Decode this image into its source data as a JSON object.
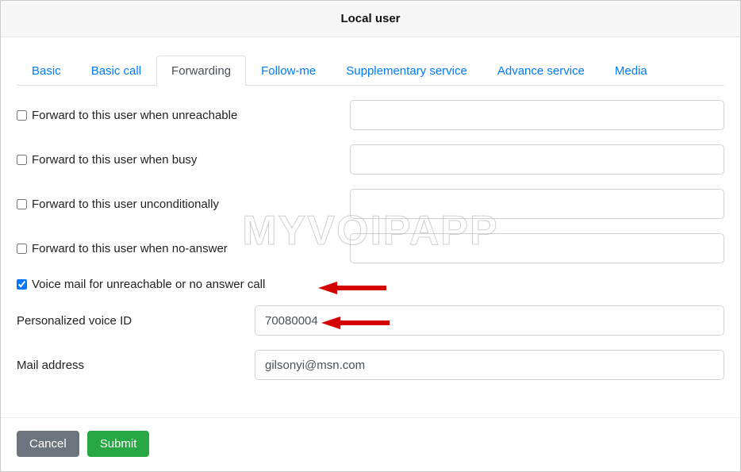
{
  "header": {
    "title": "Local user"
  },
  "tabs": [
    {
      "label": "Basic"
    },
    {
      "label": "Basic call"
    },
    {
      "label": "Forwarding",
      "active": true
    },
    {
      "label": "Follow-me"
    },
    {
      "label": "Supplementary service"
    },
    {
      "label": "Advance service"
    },
    {
      "label": "Media"
    }
  ],
  "forwarding": {
    "unreachable": {
      "label": "Forward to this user when unreachable",
      "checked": false,
      "value": ""
    },
    "busy": {
      "label": "Forward to this user when busy",
      "checked": false,
      "value": ""
    },
    "uncond": {
      "label": "Forward to this user unconditionally",
      "checked": false,
      "value": ""
    },
    "noanswer": {
      "label": "Forward to this user when no-answer",
      "checked": false,
      "value": ""
    },
    "voicemail": {
      "label": "Voice mail for unreachable or no answer call",
      "checked": true
    },
    "voiceid": {
      "label": "Personalized voice ID",
      "value": "70080004"
    },
    "mailaddr": {
      "label": "Mail address",
      "value": "gilsonyi@msn.com"
    }
  },
  "footer": {
    "cancel_label": "Cancel",
    "submit_label": "Submit"
  },
  "watermark": "MYVOIPAPP"
}
